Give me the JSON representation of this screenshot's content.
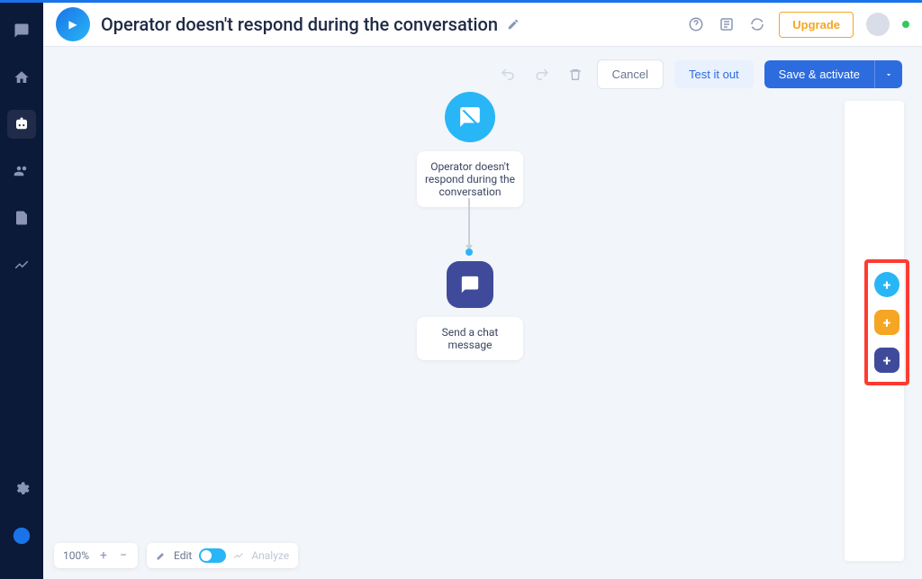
{
  "header": {
    "title": "Operator doesn't respond during the conversation",
    "upgrade_label": "Upgrade"
  },
  "toolbar": {
    "cancel_label": "Cancel",
    "test_label": "Test it out",
    "save_label": "Save & activate"
  },
  "nodes": {
    "trigger": {
      "label": "Operator doesn't respond during the conversation"
    },
    "action": {
      "label": "Send a chat message"
    }
  },
  "right_panel": {
    "add_trigger_icon": "+",
    "add_condition_icon": "+",
    "add_action_icon": "+"
  },
  "bottom": {
    "zoom": "100%",
    "edit_label": "Edit",
    "analyze_label": "Analyze"
  },
  "colors": {
    "accent_blue": "#2d6cdf",
    "cyan": "#29b6f6",
    "orange": "#f5a623",
    "indigo": "#3f4b9a",
    "highlight": "#ff3b30"
  }
}
